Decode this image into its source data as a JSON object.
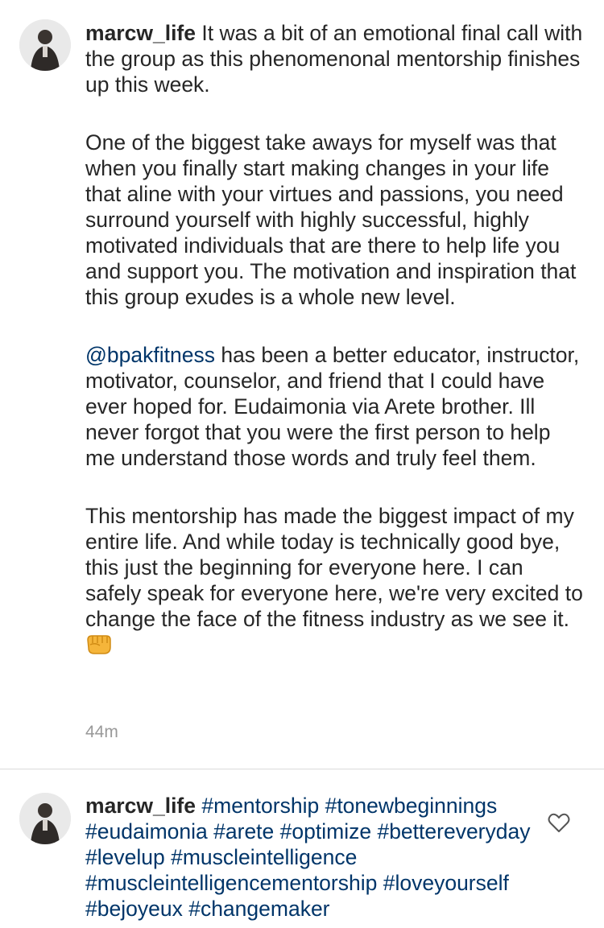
{
  "comments": [
    {
      "username": "marcw_life",
      "paragraphs": {
        "p1": "It was a bit of an emotional final call with the group as this phenomenonal mentorship finishes up this week.",
        "p2": "One of the biggest take aways for myself was that when you finally start making changes in your life that aline with your virtues and passions, you need surround yourself with highly successful, highly motivated individuals that are there to help life you and support you. The motivation and inspiration that this group exudes is a whole new level.",
        "p3_mention": "@bpakfitness",
        "p3_rest": " has been a better educator, instructor, motivator, counselor, and friend that I could have ever hoped for. Eudaimonia via Arete brother. Ill never forgot that you were the first person to help me understand those words and truly feel them.",
        "p4": "This mentorship has made the biggest impact of my entire life. And while today is technically good bye, this just the beginning for everyone here. I can safely speak for everyone here, we're very excited to change the face of the fitness industry as we see it. "
      },
      "emoji": "fist-bump-icon",
      "timestamp": "44m"
    },
    {
      "username": "marcw_life",
      "hashtags": [
        "#mentorship",
        "#tonewbeginnings",
        "#eudaimonia",
        "#arete",
        "#optimize",
        "#bettereveryday",
        "#levelup",
        "#muscleintelligence",
        "#muscleintelligencementorship",
        "#loveyourself",
        "#bejoyeux",
        "#changemaker"
      ],
      "like_icon": "heart-outline-icon"
    }
  ],
  "colors": {
    "text": "#262626",
    "link": "#003569",
    "timestamp": "#999999",
    "divider": "#dbdbdb"
  }
}
